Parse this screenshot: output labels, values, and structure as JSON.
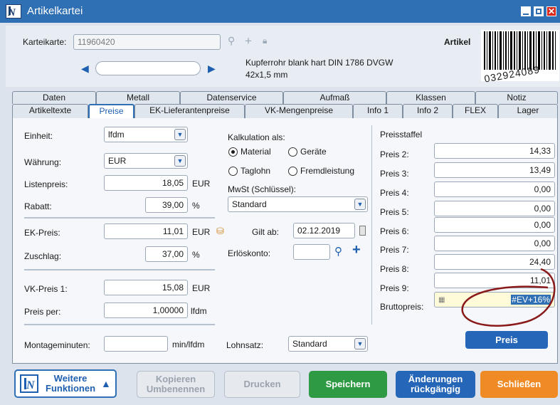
{
  "window": {
    "title": "Artikelkartei"
  },
  "header": {
    "karteikarte_label": "Karteikarte:",
    "karteikarte_value": "11960420",
    "artikel_label": "Artikel",
    "description_line1": "Kupferrohr blank hart DIN 1786 DVGW",
    "description_line2": "42x1,5 mm",
    "barcode_digits": "032924089"
  },
  "tabs_row1": [
    "Daten",
    "Metall",
    "Datenservice",
    "Aufmaß",
    "Klassen",
    "Notiz"
  ],
  "tabs_row2": [
    "Artikeltexte",
    "Preise",
    "EK-Lieferantenpreise",
    "VK-Mengenpreise",
    "Info 1",
    "Info 2",
    "FLEX",
    "Lager"
  ],
  "active_tab": "Preise",
  "left": {
    "einheit_label": "Einheit:",
    "einheit_value": "lfdm",
    "waehrung_label": "Währung:",
    "waehrung_value": "EUR",
    "listenpreis_label": "Listenpreis:",
    "listenpreis_value": "18,05",
    "listenpreis_unit": "EUR",
    "rabatt_label": "Rabatt:",
    "rabatt_value": "39,00",
    "rabatt_unit": "%",
    "ekpreis_label": "EK-Preis:",
    "ekpreis_value": "11,01",
    "ekpreis_unit": "EUR",
    "zuschlag_label": "Zuschlag:",
    "zuschlag_value": "37,00",
    "zuschlag_unit": "%",
    "vkpreis_label": "VK-Preis 1:",
    "vkpreis_value": "15,08",
    "vkpreis_unit": "EUR",
    "preisper_label": "Preis per:",
    "preisper_value": "1,00000",
    "preisper_unit": "lfdm",
    "montage_label": "Montageminuten:",
    "montage_value": "",
    "montage_unit": "min/lfdm"
  },
  "middle": {
    "kalkulation_label": "Kalkulation als:",
    "radio_material": "Material",
    "radio_geraete": "Geräte",
    "radio_tagelohn": "Taglohn",
    "radio_fremdleistung": "Fremdleistung",
    "selected_radio": "Material",
    "mwst_label": "MwSt (Schlüssel):",
    "mwst_value": "Standard",
    "giltab_label": "Gilt ab:",
    "giltab_value": "02.12.2019",
    "erloeskonto_label": "Erlöskonto:",
    "erloeskonto_value": "",
    "lohnsatz_label": "Lohnsatz:",
    "lohnsatz_value": "Standard"
  },
  "preisstaffel": {
    "title": "Preisstaffel",
    "rows": [
      {
        "label": "Preis 2:",
        "value": "14,33"
      },
      {
        "label": "Preis 3:",
        "value": "13,49"
      },
      {
        "label": "Preis 4:",
        "value": "0,00"
      },
      {
        "label": "Preis 5:",
        "value": "0,00"
      },
      {
        "label": "Preis 6:",
        "value": "0,00"
      },
      {
        "label": "Preis 7:",
        "value": "0,00"
      },
      {
        "label": "Preis 8:",
        "value": "24,40"
      },
      {
        "label": "Preis 9:",
        "value": "11,01"
      }
    ],
    "brutto_label": "Bruttopreis:",
    "brutto_value": "#EV+16%",
    "preis_button": "Preis"
  },
  "footer": {
    "weitere_line1": "Weitere",
    "weitere_line2": "Funktionen",
    "kopieren_line1": "Kopieren",
    "kopieren_line2": "Umbenennen",
    "drucken": "Drucken",
    "speichern": "Speichern",
    "aenderungen_line1": "Änderungen",
    "aenderungen_line2": "rückgängig",
    "schliessen": "Schließen"
  },
  "colors": {
    "accent": "#2f6fb3",
    "annotation": "#8a1a1a",
    "green": "#2f9a44",
    "orange": "#f08a24"
  }
}
